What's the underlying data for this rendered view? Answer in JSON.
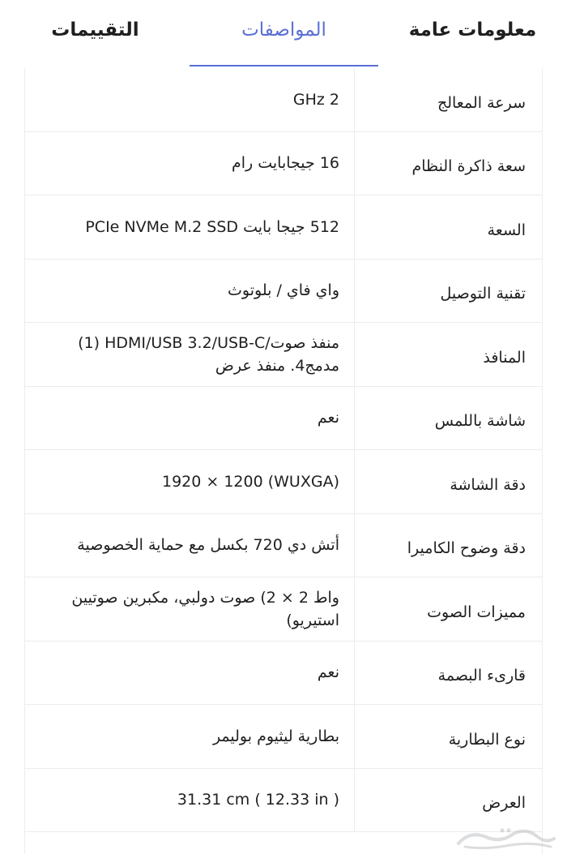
{
  "tabs": [
    {
      "label": "معلومات عامة",
      "active": false
    },
    {
      "label": "المواصفات",
      "active": true
    },
    {
      "label": "التقييمات",
      "active": false
    }
  ],
  "specs": [
    {
      "label": "سرعة المعالج",
      "value": "GHz 2"
    },
    {
      "label": "سعة ذاكرة النظام",
      "value": "16 جيجابايت رام"
    },
    {
      "label": "السعة",
      "value": "512 جيجا بايت PCIe NVMe M.2 SSD"
    },
    {
      "label": "تقنية التوصيل",
      "value": "واي فاي / بلوتوث"
    },
    {
      "label": "المنافذ",
      "value": "(1) HDMI/USB 3.2/USB-C/منفذ صوت مدمج4. منفذ عرض"
    },
    {
      "label": "شاشة باللمس",
      "value": "نعم"
    },
    {
      "label": "دقة الشاشة",
      "value": "1920 × 1200 (WUXGA)"
    },
    {
      "label": "دقة وضوح الكاميرا",
      "value": "أتش دي 720 بكسل مع حماية الخصوصية"
    },
    {
      "label": "مميزات الصوت",
      "value": "واط 2 × 2) صوت دولبي، مكبرين صوتيين استيريو)"
    },
    {
      "label": "قارىء البصمة",
      "value": "نعم"
    },
    {
      "label": "نوع البطارية",
      "value": "بطارية ليثيوم بوليمر"
    },
    {
      "label": "العرض",
      "value": "31.31 cm ( 12.33 in )"
    }
  ],
  "watermark": {
    "text": "حراج",
    "icon": "haraj-logo-icon",
    "color": "#9aa0a6"
  },
  "colors": {
    "accent": "#5b6fd6",
    "text": "#1f1f1f",
    "divider": "#ececec"
  }
}
